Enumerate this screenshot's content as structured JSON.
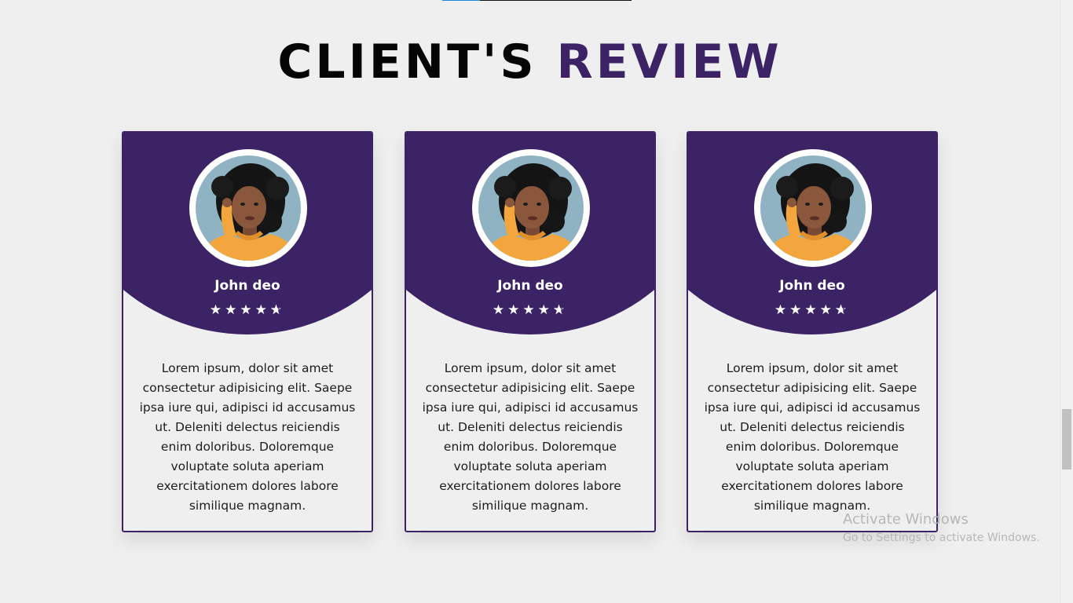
{
  "section": {
    "title_part1": "CLIENT'S",
    "title_part2": "REVIEW"
  },
  "reviews": [
    {
      "name": "John deo",
      "rating": 4.5,
      "text": "Lorem ipsum, dolor sit amet consectetur adipisicing elit. Saepe ipsa iure qui, adipisci id accusamus ut. Deleniti delectus reiciendis enim doloribus. Doloremque voluptate soluta aperiam exercitationem dolores labore similique magnam."
    },
    {
      "name": "John deo",
      "rating": 4.5,
      "text": "Lorem ipsum, dolor sit amet consectetur adipisicing elit. Saepe ipsa iure qui, adipisci id accusamus ut. Deleniti delectus reiciendis enim doloribus. Doloremque voluptate soluta aperiam exercitationem dolores labore similique magnam."
    },
    {
      "name": "John deo",
      "rating": 4.5,
      "text": "Lorem ipsum, dolor sit amet consectetur adipisicing elit. Saepe ipsa iure qui, adipisci id accusamus ut. Deleniti delectus reiciendis enim doloribus. Doloremque voluptate soluta aperiam exercitationem dolores labore similique magnam."
    }
  ],
  "watermark": {
    "line1": "Activate Windows",
    "line2": "Go to Settings to activate Windows."
  },
  "colors": {
    "accent": "#3b2365",
    "background": "#efefef"
  }
}
